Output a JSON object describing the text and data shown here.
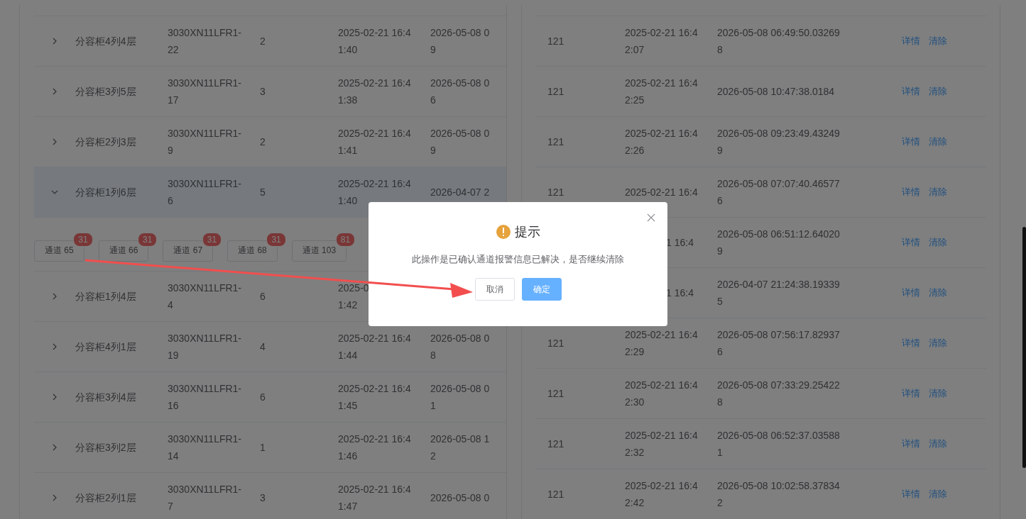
{
  "left_table": {
    "rows": [
      {
        "expanded": false,
        "name": "分容柜4列4层",
        "code": [
          "3030XN11LFR1-",
          "22"
        ],
        "count": "2",
        "start": [
          "2025-02-21 16:4",
          "1:40"
        ],
        "latest": [
          "2026-05-08 0",
          "9"
        ]
      },
      {
        "expanded": false,
        "name": "分容柜3列5层",
        "code": [
          "3030XN11LFR1-",
          "17"
        ],
        "count": "3",
        "start": [
          "2025-02-21 16:4",
          "1:38"
        ],
        "latest": [
          "2026-05-08 0",
          "6"
        ]
      },
      {
        "expanded": false,
        "name": "分容柜2列3层",
        "code": [
          "3030XN11LFR1-",
          "9"
        ],
        "count": "2",
        "start": [
          "2025-02-21 16:4",
          "1:41"
        ],
        "latest": [
          "2026-05-08 0",
          "9"
        ]
      },
      {
        "expanded": true,
        "name": "分容柜1列6层",
        "code": [
          "3030XN11LFR1-",
          "6"
        ],
        "count": "5",
        "start": [
          "2025-02-21 16:4",
          "1:40"
        ],
        "latest": [
          "2026-04-07 2"
        ],
        "channels": [
          {
            "label": "通道 65",
            "badge": "31"
          },
          {
            "label": "通道 66",
            "badge": "31"
          },
          {
            "label": "通道 67",
            "badge": "31"
          },
          {
            "label": "通道 68",
            "badge": "31"
          },
          {
            "label": "通道 103",
            "badge": "81"
          }
        ]
      },
      {
        "expanded": false,
        "name": "分容柜1列4层",
        "code": [
          "3030XN11LFR1-",
          "4"
        ],
        "count": "6",
        "start": [
          "2025-0",
          "1:42"
        ]
      },
      {
        "expanded": false,
        "name": "分容柜4列1层",
        "code": [
          "3030XN11LFR1-",
          "19"
        ],
        "count": "4",
        "start": [
          "2025-02-21 16:4",
          "1:44"
        ],
        "latest": [
          "2026-05-08 0",
          "8"
        ]
      },
      {
        "expanded": false,
        "name": "分容柜3列4层",
        "code": [
          "3030XN11LFR1-",
          "16"
        ],
        "count": "6",
        "start": [
          "2025-02-21 16:4",
          "1:45"
        ],
        "latest": [
          "2026-05-08 0",
          "1"
        ]
      },
      {
        "expanded": false,
        "name": "分容柜3列2层",
        "code": [
          "3030XN11LFR1-",
          "14"
        ],
        "count": "1",
        "start": [
          "2025-02-21 16:4",
          "1:46"
        ],
        "latest": [
          "2026-05-08 1",
          "2"
        ]
      },
      {
        "expanded": false,
        "name": "分容柜2列1层",
        "code": [
          "3030XN11LFR1-",
          "7"
        ],
        "count": "3",
        "start": [
          "2025-02-21 16:4",
          "1:47"
        ],
        "latest": [
          "2026-05-08 0"
        ]
      }
    ]
  },
  "right_table": {
    "rows": [
      {
        "count": "121",
        "start": [
          "2025-02-21 16:4",
          "2:07"
        ],
        "alarm": [
          "2026-05-08 06:49:50.03269",
          "8"
        ],
        "actions": [
          "详情",
          "清除"
        ]
      },
      {
        "count": "121",
        "start": [
          "2025-02-21 16:4",
          "2:25"
        ],
        "alarm": [
          "2026-05-08 10:47:38.0184"
        ],
        "actions": [
          "详情",
          "清除"
        ]
      },
      {
        "count": "121",
        "start": [
          "2025-02-21 16:4",
          "2:26"
        ],
        "alarm": [
          "2026-05-08 09:23:49.43249",
          "9"
        ],
        "actions": [
          "详情",
          "清除"
        ]
      },
      {
        "count": "121",
        "start": [
          "2025-02-21 16:4"
        ],
        "alarm": [
          "2026-05-08 07:07:40.46577",
          "6"
        ],
        "actions": [
          "详情",
          "清除"
        ]
      },
      {
        "start_cut": true,
        "start": [
          "1 16:4"
        ],
        "alarm": [
          "2026-05-08 06:51:12.64020",
          "9"
        ],
        "actions": [
          "详情",
          "清除"
        ]
      },
      {
        "start_cut": true,
        "start": [
          "1 16:4"
        ],
        "alarm": [
          "2026-04-07 21:24:38.19339",
          "5"
        ],
        "actions": [
          "详情",
          "清除"
        ]
      },
      {
        "count": "121",
        "start": [
          "2025-02-21 16:4",
          "2:29"
        ],
        "alarm": [
          "2026-05-08 07:56:17.82937",
          "6"
        ],
        "actions": [
          "详情",
          "清除"
        ]
      },
      {
        "count": "121",
        "start": [
          "2025-02-21 16:4",
          "2:30"
        ],
        "alarm": [
          "2026-05-08 07:33:29.25422",
          "8"
        ],
        "actions": [
          "详情",
          "清除"
        ]
      },
      {
        "count": "121",
        "start": [
          "2025-02-21 16:4",
          "2:32"
        ],
        "alarm": [
          "2026-05-08 06:52:37.03588",
          "1"
        ],
        "actions": [
          "详情",
          "清除"
        ]
      },
      {
        "count": "121",
        "start": [
          "2025-02-21 16:4",
          "2:42"
        ],
        "alarm": [
          "2026-05-08 10:02:58.37834",
          "2"
        ],
        "actions": [
          "详情",
          "清除"
        ]
      }
    ]
  },
  "dialog": {
    "title": "提示",
    "message": "此操作是已确认通道报警信息已解决，是否继续清除",
    "buttons": [
      {
        "label": "取消",
        "kind": "secondary"
      },
      {
        "label": "确定",
        "kind": "primary"
      }
    ]
  }
}
